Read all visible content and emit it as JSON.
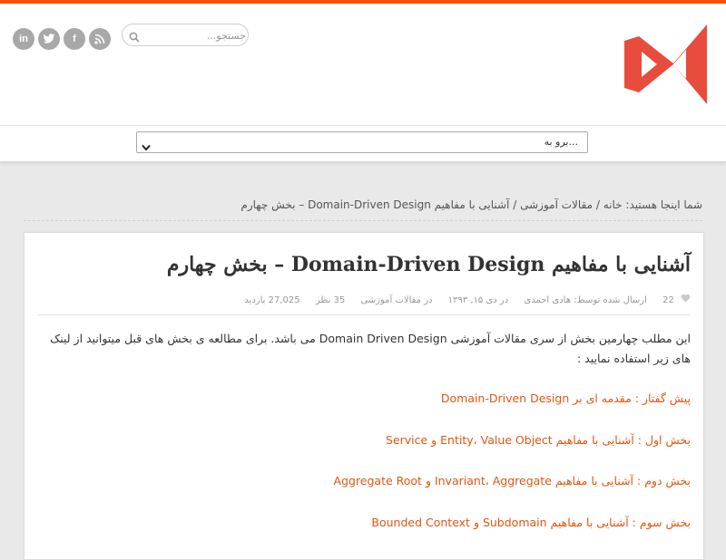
{
  "colors": {
    "accent": "#ff4e00",
    "link": "#e2560f",
    "logo": "#e84c3d",
    "social": "#a8a8a8"
  },
  "header": {
    "social_icons": [
      {
        "icon": "linkedin-icon",
        "glyph": "in"
      },
      {
        "icon": "twitter-icon",
        "glyph": "t"
      },
      {
        "icon": "facebook-icon",
        "glyph": "f"
      },
      {
        "icon": "rss-icon",
        "glyph": "))"
      }
    ],
    "search": {
      "placeholder": "جستجو..."
    }
  },
  "nav": {
    "select_value": "برو به..."
  },
  "breadcrumb": {
    "prefix": "شما اینجا هستید:",
    "home": "خانه",
    "category": "مقالات آموزشی",
    "current": "آشنایی با مفاهیم Domain-Driven Design – بخش چهارم",
    "separator": "/"
  },
  "post": {
    "title": "آشنایی با مفاهیم Domain-Driven Design – بخش چهارم",
    "meta": {
      "likes": "22",
      "author": "ارسال شده توسط: هادی احمدی",
      "date": "در دی ۱۵, ۱۳۹۳",
      "category": "در مقالات آموزشی",
      "comments": "35 نظر",
      "views": "27,025 بازدید"
    },
    "intro": "این مطلب چهارمین بخش از سری مقالات آموزشی Domain Driven Design می باشد. برای مطالعه ی بخش های قبل میتوانید از لینک های زیر استفاده نمایید :",
    "links": [
      "پیش گفتار : مقدمه ای بر Domain-Driven Design",
      "بخش اول : آشنایی با مفاهیم Entity، Value Object و Service",
      "بخش دوم : آشنایی با مفاهیم Invariant، Aggregate و Aggregate Root",
      "بخش سوم : آشنایی با مفاهیم Subdomain و Bounded Context"
    ]
  }
}
